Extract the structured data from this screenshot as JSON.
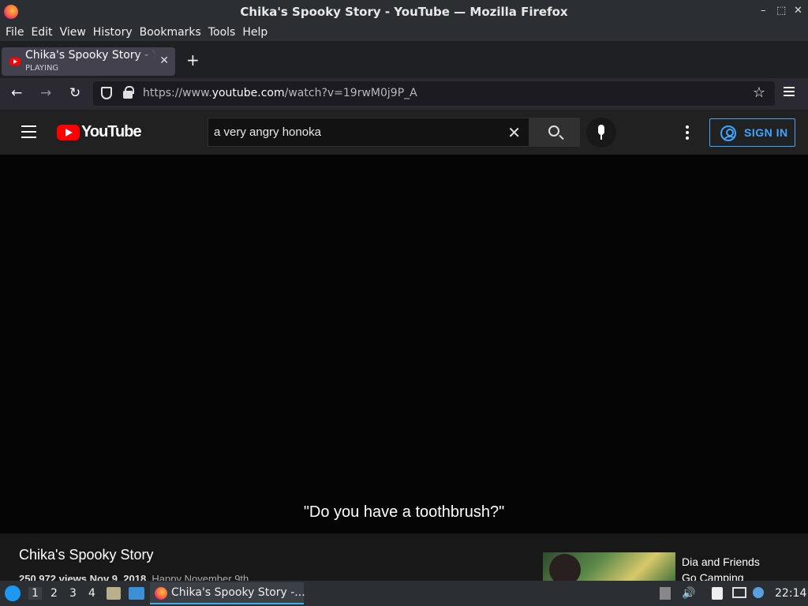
{
  "window": {
    "title": "Chika's Spooky Story - YouTube — Mozilla Firefox",
    "controls": {
      "minimize": "–",
      "maximize": "⬚",
      "close": "✕"
    }
  },
  "menubar": {
    "items": [
      "File",
      "Edit",
      "View",
      "History",
      "Bookmarks",
      "Tools",
      "Help"
    ]
  },
  "tabs": [
    {
      "title": "Chika's Spooky Story - YouTube",
      "status": "PLAYING",
      "close": "✕"
    }
  ],
  "new_tab": "+",
  "navbar": {
    "back": "←",
    "forward": "→",
    "reload": "↻",
    "url_prefix": "https://www.",
    "url_domain": "youtube.com",
    "url_path": "/watch?v=19rwM0j9P_A",
    "bookmark_star": "☆"
  },
  "youtube": {
    "logo_text": "YouTube",
    "search_query": "a very angry honoka",
    "clear_icon": "✕",
    "sign_in_label": "SIGN IN"
  },
  "video": {
    "caption": "\"Do you have a toothbrush?\"",
    "title": "Chika's Spooky Story",
    "views_date": "250,972 views  Nov 9, 2018",
    "description_start": "Happy November 9th"
  },
  "recommended": [
    {
      "title_line1": "Dia and Friends",
      "title_line2": "Go Camping"
    }
  ],
  "taskbar": {
    "workspaces": [
      "1",
      "2",
      "3",
      "4"
    ],
    "active_workspace": "1",
    "task_title": "Chika's Spooky Story -...",
    "clock": "22:14"
  },
  "colors": {
    "accent": "#3ea6ff",
    "yt_red": "#ff0000",
    "taskbar_active": "#3daee9"
  }
}
